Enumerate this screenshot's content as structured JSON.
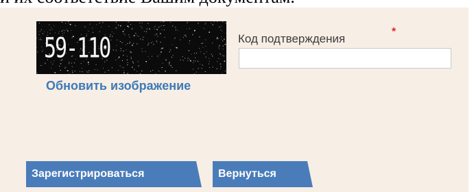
{
  "page": {
    "top_text": "и их соответствие Вашим документам."
  },
  "captcha": {
    "image_text": "59-110",
    "refresh_label": "Обновить изображение"
  },
  "form": {
    "code_label": "Код подтверждения",
    "required_mark": "*",
    "code_value": ""
  },
  "buttons": {
    "register_label": "Зарегистрироваться",
    "back_label": "Вернуться"
  },
  "colors": {
    "panel_bg": "#f7eee5",
    "button_bg": "#4a7cba",
    "link": "#3d7ab7",
    "required": "#e8242b"
  }
}
